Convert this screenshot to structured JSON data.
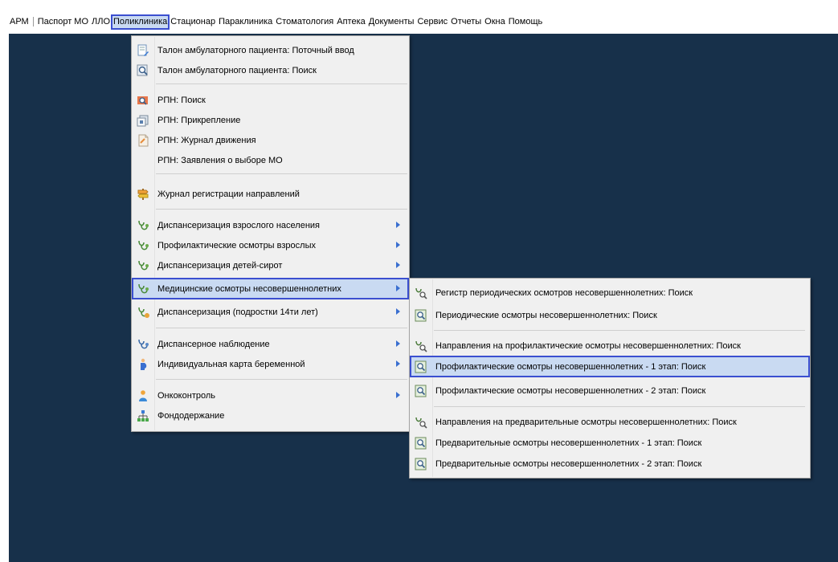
{
  "menubar": {
    "items": [
      {
        "label": "АРМ"
      },
      {
        "label": "Паспорт МО"
      },
      {
        "label": "ЛЛО"
      },
      {
        "label": "Поликлиника"
      },
      {
        "label": "Стационар"
      },
      {
        "label": "Параклиника"
      },
      {
        "label": "Стоматология"
      },
      {
        "label": "Аптека"
      },
      {
        "label": "Документы"
      },
      {
        "label": "Сервис"
      },
      {
        "label": "Отчеты"
      },
      {
        "label": "Окна"
      },
      {
        "label": "Помощь"
      }
    ],
    "active": "Поликлиника"
  },
  "polyclinic_menu": {
    "items": [
      {
        "label": "Талон амбулаторного пациента: Поточный ввод",
        "icon": "ticket-edit-icon"
      },
      {
        "label": "Талон амбулаторного пациента: Поиск",
        "icon": "ticket-search-icon"
      },
      {
        "label": "РПН: Поиск",
        "icon": "rpn-search-icon"
      },
      {
        "label": "РПН: Прикрепление",
        "icon": "rpn-attach-icon"
      },
      {
        "label": "РПН: Журнал движения",
        "icon": "rpn-journal-icon"
      },
      {
        "label": "РПН: Заявления о выборе МО",
        "icon": ""
      },
      {
        "label": "Журнал регистрации направлений",
        "icon": "signpost-icon"
      },
      {
        "label": "Диспансеризация взрослого населения",
        "icon": "stethoscope-icon",
        "submenu": true
      },
      {
        "label": "Профилактические осмотры взрослых",
        "icon": "stethoscope-icon",
        "submenu": true
      },
      {
        "label": "Диспансеризация детей-сирот",
        "icon": "stethoscope-icon",
        "submenu": true
      },
      {
        "label": "Медицинские осмотры несовершеннолетних",
        "icon": "stethoscope-icon",
        "submenu": true,
        "highlight": true
      },
      {
        "label": "Диспансеризация (подростки 14ти лет)",
        "icon": "stethoscope-teen-icon",
        "submenu": true
      },
      {
        "label": "Диспансерное наблюдение",
        "icon": "stethoscope-icon",
        "submenu": true
      },
      {
        "label": "Индивидуальная карта беременной",
        "icon": "pregnant-icon",
        "submenu": true
      },
      {
        "label": "Онкоконтроль",
        "icon": "person-icon",
        "submenu": true
      },
      {
        "label": "Фондодержание",
        "icon": "hierarchy-icon"
      }
    ]
  },
  "minors_submenu": {
    "items": [
      {
        "label": "Регистр периодических осмотров несовершеннолетних: Поиск",
        "icon": "stethoscope-search-icon"
      },
      {
        "label": "Периодические осмотры несовершеннолетних: Поиск",
        "icon": "doc-search-icon"
      },
      {
        "label": "Направления на профилактические осмотры несовершеннолетних: Поиск",
        "icon": "stethoscope-search-icon"
      },
      {
        "label": "Профилактические осмотры несовершеннолетних - 1 этап: Поиск",
        "icon": "doc-search-icon",
        "highlight": true
      },
      {
        "label": "Профилактические осмотры несовершеннолетних - 2 этап: Поиск",
        "icon": "doc-search-icon"
      },
      {
        "label": "Направления на предварительные осмотры несовершеннолетних: Поиск",
        "icon": "stethoscope-search-icon"
      },
      {
        "label": "Предварительные осмотры несовершеннолетних - 1 этап: Поиск",
        "icon": "doc-search-icon"
      },
      {
        "label": "Предварительные осмотры несовершеннолетних - 2 этап: Поиск",
        "icon": "doc-search-icon"
      }
    ]
  },
  "colors": {
    "workspace": "#17304a",
    "menu_bg": "#f0f0f0",
    "highlight_bg": "#c9daf2",
    "highlight_border": "#3b4fd0",
    "submenu_arrow": "#3a6fd0"
  }
}
